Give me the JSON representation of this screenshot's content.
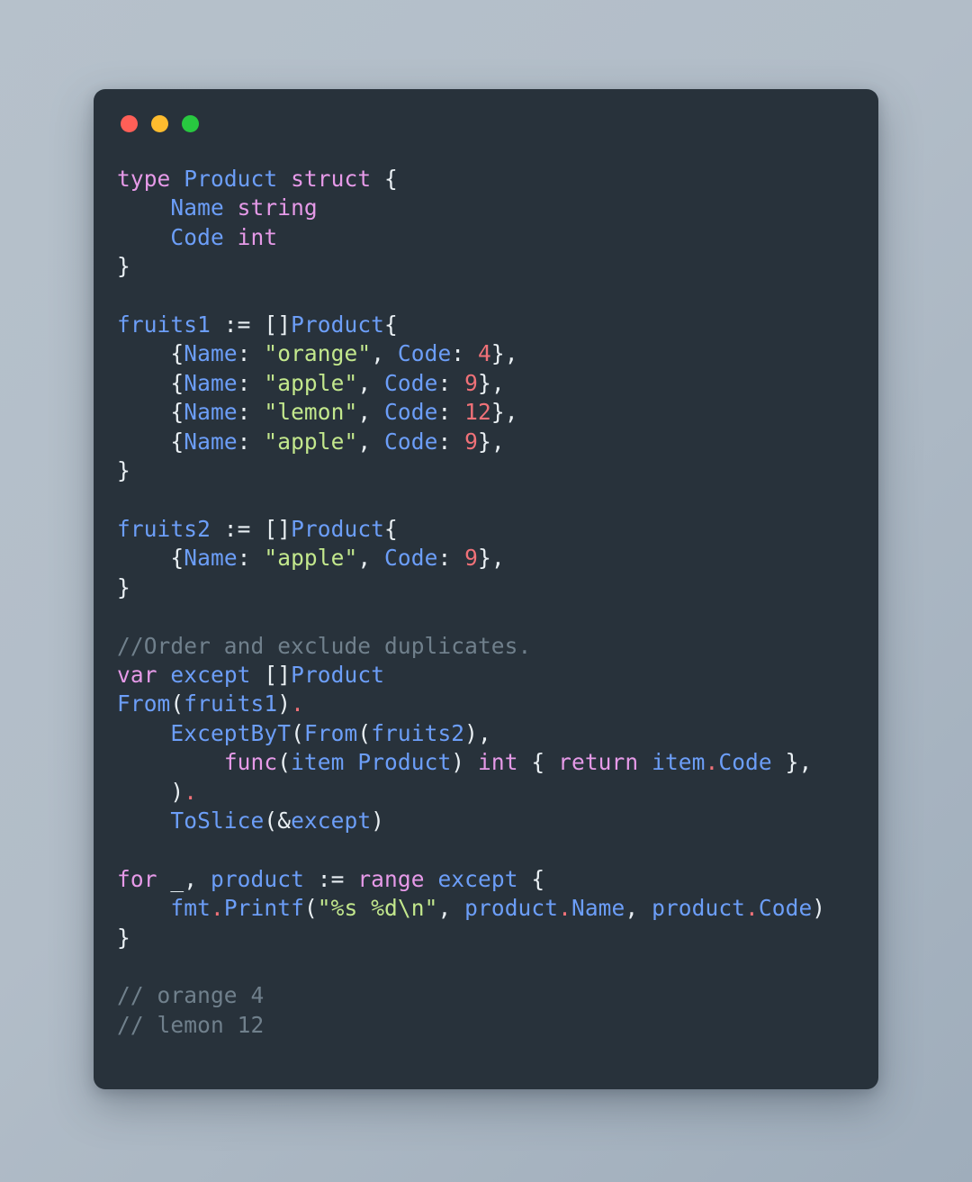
{
  "window": {
    "traffic_lights": [
      {
        "name": "close-button",
        "label": "Close",
        "color": "#ff5f57"
      },
      {
        "name": "minimize-button",
        "label": "Minimize",
        "color": "#febc2e"
      },
      {
        "name": "maximize-button",
        "label": "Maximize",
        "color": "#28c840"
      }
    ]
  },
  "theme": {
    "page_background": "#b2bdc8",
    "panel_background": "#28323b",
    "plain": "#e9eff3",
    "keyword": "#e69ae8",
    "identifier": "#6c9ef8",
    "string": "#c3e88d",
    "number": "#f07178",
    "comment": "#70808c",
    "dot": "#f07178"
  },
  "code": {
    "language": "go",
    "plain_text": "type Product struct {\n    Name string\n    Code int\n}\n\nfruits1 := []Product{\n    {Name: \"orange\", Code: 4},\n    {Name: \"apple\", Code: 9},\n    {Name: \"lemon\", Code: 12},\n    {Name: \"apple\", Code: 9},\n}\n\nfruits2 := []Product{\n    {Name: \"apple\", Code: 9},\n}\n\n//Order and exclude duplicates.\nvar except []Product\nFrom(fruits1).\n    ExceptByT(From(fruits2),\n        func(item Product) int { return item.Code },\n    ).\n    ToSlice(&except)\n\nfor _, product := range except {\n    fmt.Printf(\"%s %d\\n\", product.Name, product.Code)\n}\n\n// orange 4\n// lemon 12",
    "lines": [
      [
        {
          "c": "kw",
          "t": "type"
        },
        {
          "c": "plain",
          "t": " "
        },
        {
          "c": "ident",
          "t": "Product"
        },
        {
          "c": "plain",
          "t": " "
        },
        {
          "c": "kw",
          "t": "struct"
        },
        {
          "c": "punct",
          "t": " {"
        }
      ],
      [
        {
          "c": "punct",
          "t": "    "
        },
        {
          "c": "ident",
          "t": "Name"
        },
        {
          "c": "plain",
          "t": " "
        },
        {
          "c": "kw",
          "t": "string"
        }
      ],
      [
        {
          "c": "punct",
          "t": "    "
        },
        {
          "c": "ident",
          "t": "Code"
        },
        {
          "c": "plain",
          "t": " "
        },
        {
          "c": "kw",
          "t": "int"
        }
      ],
      [
        {
          "c": "punct",
          "t": "}"
        }
      ],
      [],
      [
        {
          "c": "ident",
          "t": "fruits1"
        },
        {
          "c": "punct",
          "t": " := []"
        },
        {
          "c": "ident",
          "t": "Product"
        },
        {
          "c": "punct",
          "t": "{"
        }
      ],
      [
        {
          "c": "punct",
          "t": "    {"
        },
        {
          "c": "ident",
          "t": "Name"
        },
        {
          "c": "punct",
          "t": ": "
        },
        {
          "c": "str",
          "t": "\"orange\""
        },
        {
          "c": "punct",
          "t": ", "
        },
        {
          "c": "ident",
          "t": "Code"
        },
        {
          "c": "punct",
          "t": ": "
        },
        {
          "c": "num",
          "t": "4"
        },
        {
          "c": "punct",
          "t": "},"
        }
      ],
      [
        {
          "c": "punct",
          "t": "    {"
        },
        {
          "c": "ident",
          "t": "Name"
        },
        {
          "c": "punct",
          "t": ": "
        },
        {
          "c": "str",
          "t": "\"apple\""
        },
        {
          "c": "punct",
          "t": ", "
        },
        {
          "c": "ident",
          "t": "Code"
        },
        {
          "c": "punct",
          "t": ": "
        },
        {
          "c": "num",
          "t": "9"
        },
        {
          "c": "punct",
          "t": "},"
        }
      ],
      [
        {
          "c": "punct",
          "t": "    {"
        },
        {
          "c": "ident",
          "t": "Name"
        },
        {
          "c": "punct",
          "t": ": "
        },
        {
          "c": "str",
          "t": "\"lemon\""
        },
        {
          "c": "punct",
          "t": ", "
        },
        {
          "c": "ident",
          "t": "Code"
        },
        {
          "c": "punct",
          "t": ": "
        },
        {
          "c": "num",
          "t": "12"
        },
        {
          "c": "punct",
          "t": "},"
        }
      ],
      [
        {
          "c": "punct",
          "t": "    {"
        },
        {
          "c": "ident",
          "t": "Name"
        },
        {
          "c": "punct",
          "t": ": "
        },
        {
          "c": "str",
          "t": "\"apple\""
        },
        {
          "c": "punct",
          "t": ", "
        },
        {
          "c": "ident",
          "t": "Code"
        },
        {
          "c": "punct",
          "t": ": "
        },
        {
          "c": "num",
          "t": "9"
        },
        {
          "c": "punct",
          "t": "},"
        }
      ],
      [
        {
          "c": "punct",
          "t": "}"
        }
      ],
      [],
      [
        {
          "c": "ident",
          "t": "fruits2"
        },
        {
          "c": "punct",
          "t": " := []"
        },
        {
          "c": "ident",
          "t": "Product"
        },
        {
          "c": "punct",
          "t": "{"
        }
      ],
      [
        {
          "c": "punct",
          "t": "    {"
        },
        {
          "c": "ident",
          "t": "Name"
        },
        {
          "c": "punct",
          "t": ": "
        },
        {
          "c": "str",
          "t": "\"apple\""
        },
        {
          "c": "punct",
          "t": ", "
        },
        {
          "c": "ident",
          "t": "Code"
        },
        {
          "c": "punct",
          "t": ": "
        },
        {
          "c": "num",
          "t": "9"
        },
        {
          "c": "punct",
          "t": "},"
        }
      ],
      [
        {
          "c": "punct",
          "t": "}"
        }
      ],
      [],
      [
        {
          "c": "comment",
          "t": "//Order and exclude duplicates."
        }
      ],
      [
        {
          "c": "kw",
          "t": "var"
        },
        {
          "c": "plain",
          "t": " "
        },
        {
          "c": "ident",
          "t": "except"
        },
        {
          "c": "punct",
          "t": " []"
        },
        {
          "c": "ident",
          "t": "Product"
        }
      ],
      [
        {
          "c": "func",
          "t": "From"
        },
        {
          "c": "punct",
          "t": "("
        },
        {
          "c": "ident",
          "t": "fruits1"
        },
        {
          "c": "punct",
          "t": ")"
        },
        {
          "c": "dot",
          "t": "."
        }
      ],
      [
        {
          "c": "punct",
          "t": "    "
        },
        {
          "c": "func",
          "t": "ExceptByT"
        },
        {
          "c": "punct",
          "t": "("
        },
        {
          "c": "func",
          "t": "From"
        },
        {
          "c": "punct",
          "t": "("
        },
        {
          "c": "ident",
          "t": "fruits2"
        },
        {
          "c": "punct",
          "t": "),"
        }
      ],
      [
        {
          "c": "punct",
          "t": "        "
        },
        {
          "c": "kw",
          "t": "func"
        },
        {
          "c": "punct",
          "t": "("
        },
        {
          "c": "ident",
          "t": "item"
        },
        {
          "c": "plain",
          "t": " "
        },
        {
          "c": "ident",
          "t": "Product"
        },
        {
          "c": "punct",
          "t": ") "
        },
        {
          "c": "kw",
          "t": "int"
        },
        {
          "c": "punct",
          "t": " { "
        },
        {
          "c": "kw",
          "t": "return"
        },
        {
          "c": "plain",
          "t": " "
        },
        {
          "c": "ident",
          "t": "item"
        },
        {
          "c": "dot",
          "t": "."
        },
        {
          "c": "ident",
          "t": "Code"
        },
        {
          "c": "punct",
          "t": " },"
        }
      ],
      [
        {
          "c": "punct",
          "t": "    )"
        },
        {
          "c": "dot",
          "t": "."
        }
      ],
      [
        {
          "c": "punct",
          "t": "    "
        },
        {
          "c": "func",
          "t": "ToSlice"
        },
        {
          "c": "punct",
          "t": "(&"
        },
        {
          "c": "ident",
          "t": "except"
        },
        {
          "c": "punct",
          "t": ")"
        }
      ],
      [],
      [
        {
          "c": "kw",
          "t": "for"
        },
        {
          "c": "punct",
          "t": " _, "
        },
        {
          "c": "ident",
          "t": "product"
        },
        {
          "c": "punct",
          "t": " := "
        },
        {
          "c": "kw",
          "t": "range"
        },
        {
          "c": "plain",
          "t": " "
        },
        {
          "c": "ident",
          "t": "except"
        },
        {
          "c": "punct",
          "t": " {"
        }
      ],
      [
        {
          "c": "punct",
          "t": "    "
        },
        {
          "c": "ident",
          "t": "fmt"
        },
        {
          "c": "dot",
          "t": "."
        },
        {
          "c": "func",
          "t": "Printf"
        },
        {
          "c": "punct",
          "t": "("
        },
        {
          "c": "str",
          "t": "\"%s %d\\n\""
        },
        {
          "c": "punct",
          "t": ", "
        },
        {
          "c": "ident",
          "t": "product"
        },
        {
          "c": "dot",
          "t": "."
        },
        {
          "c": "ident",
          "t": "Name"
        },
        {
          "c": "punct",
          "t": ", "
        },
        {
          "c": "ident",
          "t": "product"
        },
        {
          "c": "dot",
          "t": "."
        },
        {
          "c": "ident",
          "t": "Code"
        },
        {
          "c": "punct",
          "t": ")"
        }
      ],
      [
        {
          "c": "punct",
          "t": "}"
        }
      ],
      [],
      [
        {
          "c": "comment",
          "t": "// orange 4"
        }
      ],
      [
        {
          "c": "comment",
          "t": "// lemon 12"
        }
      ]
    ]
  }
}
